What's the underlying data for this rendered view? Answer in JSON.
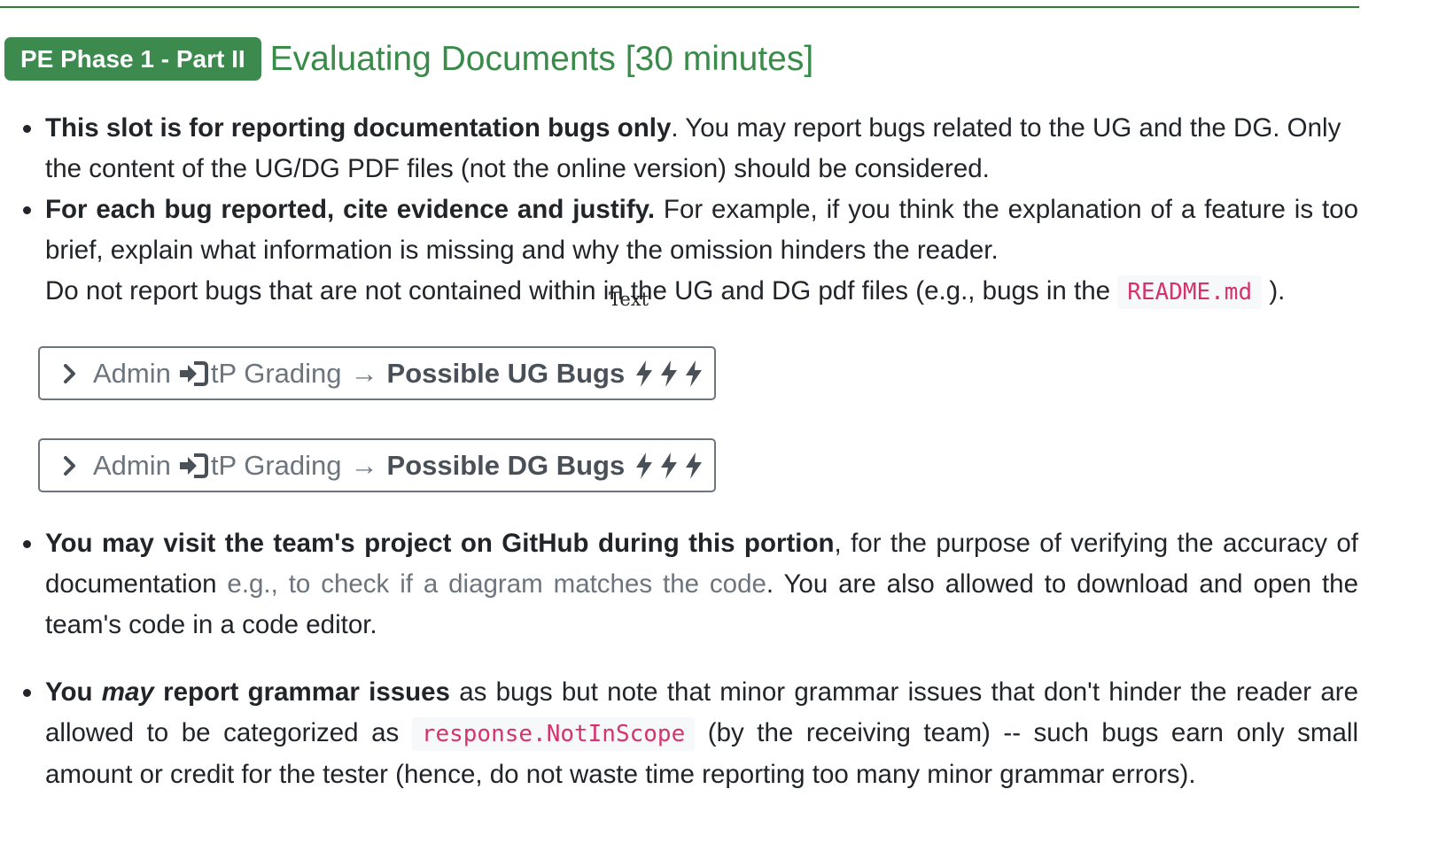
{
  "heading": {
    "badge": "PE Phase 1 - Part II",
    "title": "Evaluating Documents [30 minutes]"
  },
  "bullets": {
    "b1": {
      "bold": "This slot is for reporting documentation bugs only",
      "text": ". You may report bugs related to the UG and the DG. Only the content of the UG/DG PDF files (not the online version) should be considered."
    },
    "b2": {
      "bold": "For each bug reported, cite evidence and justify.",
      "text": " For example, if you think the explanation of a feature is too brief, explain what information is missing and why the omission hinders the reader.",
      "line3_pre": "Do not report bugs that are not contained within in the UG and DG pdf files (e.g., bugs in the",
      "code": "README.md",
      "line3_post": ")."
    },
    "b3": {
      "bold": "You may visit the team's project on GitHub during this portion",
      "text1": ", for the purpose of verifying the accuracy of documentation ",
      "muted": "e.g., to check if a diagram matches the code",
      "text2": ". You are also allowed to download and open the team's code in a code editor."
    },
    "b4": {
      "bold1": "You ",
      "bold_italic": "may",
      "bold2": " report grammar issues",
      "text1": " as bugs but note that minor grammar issues that don't hinder the reader are allowed to be categorized as ",
      "code": "response.NotInScope",
      "text2": " (by the receiving team) -- such bugs earn only small amount or credit for the tester (hence, do not waste time reporting too many minor grammar errors)."
    }
  },
  "overlay_text": "Text",
  "panels": [
    {
      "admin": "Admin",
      "section": "tP Grading",
      "arrow": "→",
      "bugs": "Possible UG Bugs",
      "icon": "sign-in-icon"
    },
    {
      "admin": "Admin",
      "section": "tP Grading",
      "arrow": "→",
      "bugs": "Possible DG Bugs",
      "icon": "sign-in-icon"
    }
  ],
  "colors": {
    "badge_bg": "#3c8a4e",
    "heading_text": "#3a8a4a",
    "code_text": "#d6336c",
    "code_bg": "#f6f8fa",
    "panel_text": "#6c757d"
  }
}
